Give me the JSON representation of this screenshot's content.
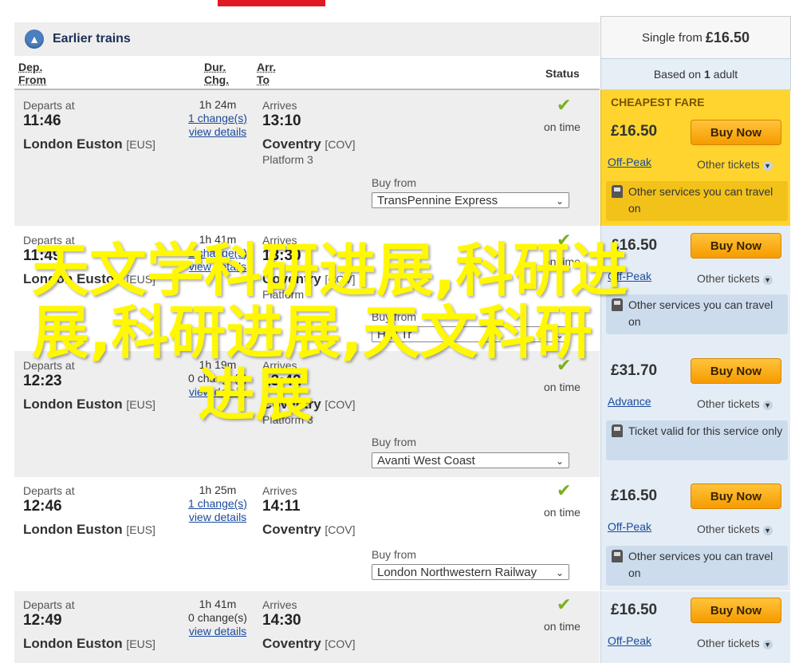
{
  "nav": {
    "earlier_trains": "Earlier trains"
  },
  "summary": {
    "single_from_prefix": "Single from",
    "single_from_price": "£16.50",
    "based_on_prefix": "Based on",
    "based_on_count": "1",
    "based_on_suffix": "adult"
  },
  "headers": {
    "dep_l1": "Dep.",
    "dep_l2": "From",
    "dur_l1": "Dur.",
    "dur_l2": "Chg.",
    "arr_l1": "Arr.",
    "arr_l2": "To",
    "status": "Status"
  },
  "labels": {
    "departs_at": "Departs at",
    "arrives": "Arrives",
    "buy_from": "Buy from",
    "view_details": "view details",
    "on_time": "on time",
    "buy_now": "Buy Now",
    "other_tickets": "Other tickets",
    "cheapest_fare": "CHEAPEST FARE"
  },
  "journeys": [
    {
      "dep_time": "11:46",
      "from": "London Euston",
      "from_code": "[EUS]",
      "duration": "1h 24m",
      "changes": "1 change(s)",
      "arr_time": "13:10",
      "to": "Coventry",
      "to_code": "[COV]",
      "platform": "Platform 3",
      "operator": "TransPennine Express",
      "price": "£16.50",
      "fare_type": "Off-Peak",
      "info": "Other services you can travel on"
    },
    {
      "dep_time": "11:49",
      "from": "London Euston",
      "from_code": "[EUS]",
      "duration": "1h 41m",
      "changes": "1 change(s)",
      "arr_time": "13:30",
      "to": "Coventry",
      "to_code": "[COV]",
      "platform": "Platform",
      "operator": "Hull Tr",
      "price": "£16.50",
      "fare_type": "Off-Peak",
      "info": "Other services you can travel on"
    },
    {
      "dep_time": "12:23",
      "from": "London Euston",
      "from_code": "[EUS]",
      "duration": "1h 19m",
      "changes": "0 change(s)",
      "arr_time": "13:42",
      "to": "Coventry",
      "to_code": "[COV]",
      "platform": "Platform 3",
      "operator": "Avanti West Coast",
      "price": "£31.70",
      "fare_type": "Advance",
      "info": "Ticket valid for this service only"
    },
    {
      "dep_time": "12:46",
      "from": "London Euston",
      "from_code": "[EUS]",
      "duration": "1h 25m",
      "changes": "1 change(s)",
      "arr_time": "14:11",
      "to": "Coventry",
      "to_code": "[COV]",
      "platform": "",
      "operator": "London Northwestern Railway",
      "price": "£16.50",
      "fare_type": "Off-Peak",
      "info": "Other services you can travel on"
    },
    {
      "dep_time": "12:49",
      "from": "London Euston",
      "from_code": "[EUS]",
      "duration": "1h 41m",
      "changes": "0 change(s)",
      "arr_time": "14:30",
      "to": "Coventry",
      "to_code": "[COV]",
      "platform": "",
      "operator": "",
      "price": "£16.50",
      "fare_type": "Off-Peak",
      "info": ""
    }
  ],
  "watermark": {
    "line1": "天文学科研进展,科研进",
    "line2": "展,科研进展,天文科研",
    "line3": "进展"
  },
  "colors": {
    "accent_red": "#e01a22",
    "cheapest": "#ffd42e",
    "buy_button": "#f59b00",
    "fare_panel": "#e4ecf5",
    "link": "#1a4a9c"
  }
}
